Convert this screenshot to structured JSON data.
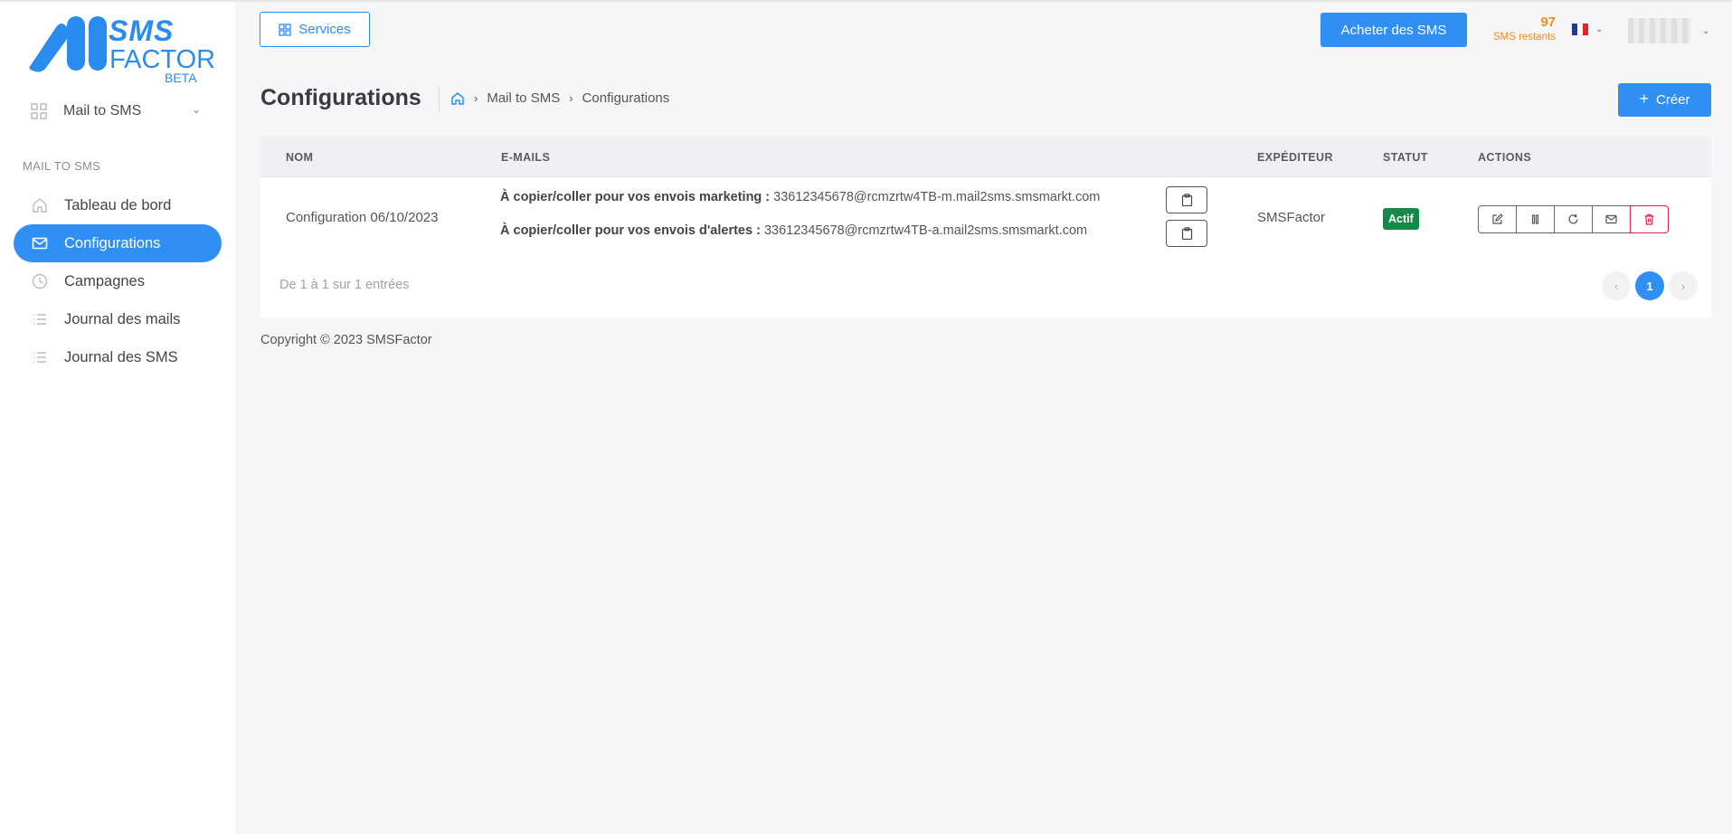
{
  "brand": {
    "logo_line1": "SMS",
    "logo_line2": "FACTOR",
    "logo_tag": "BETA",
    "color": "#2b8cf0"
  },
  "topbar": {
    "services_label": "Services",
    "buy_label": "Acheter des SMS",
    "credits_count": "97",
    "credits_label": "SMS restants",
    "language": "FR"
  },
  "sidebar": {
    "app_selector": "Mail to SMS",
    "section_title": "MAIL TO SMS",
    "items": [
      {
        "label": "Tableau de bord",
        "icon": "home-icon",
        "active": false
      },
      {
        "label": "Configurations",
        "icon": "mail-icon",
        "active": true
      },
      {
        "label": "Campagnes",
        "icon": "clock-icon",
        "active": false
      },
      {
        "label": "Journal des mails",
        "icon": "list-icon",
        "active": false
      },
      {
        "label": "Journal des SMS",
        "icon": "list-icon",
        "active": false
      }
    ]
  },
  "page": {
    "title": "Configurations",
    "breadcrumb": [
      "Mail to SMS",
      "Configurations"
    ],
    "create_label": "Créer"
  },
  "table": {
    "headers": {
      "name": "NOM",
      "emails": "E-MAILS",
      "sender": "EXPÉDITEUR",
      "status": "STATUT",
      "actions": "ACTIONS"
    },
    "rows": [
      {
        "name": "Configuration 06/10/2023",
        "marketing_label": "À copier/coller pour vos envois marketing :",
        "marketing_email": "33612345678@rcmzrtw4TB-m.mail2sms.smsmarkt.com",
        "alert_label": "À copier/coller pour vos envois d'alertes :",
        "alert_email": "33612345678@rcmzrtw4TB-a.mail2sms.smsmarkt.com",
        "sender": "SMSFactor",
        "status": "Actif"
      }
    ],
    "info": "De 1 à 1 sur 1 entrées",
    "current_page": "1",
    "status_color": "#138a47"
  },
  "footer": {
    "copyright": "Copyright © 2023 SMSFactor"
  }
}
